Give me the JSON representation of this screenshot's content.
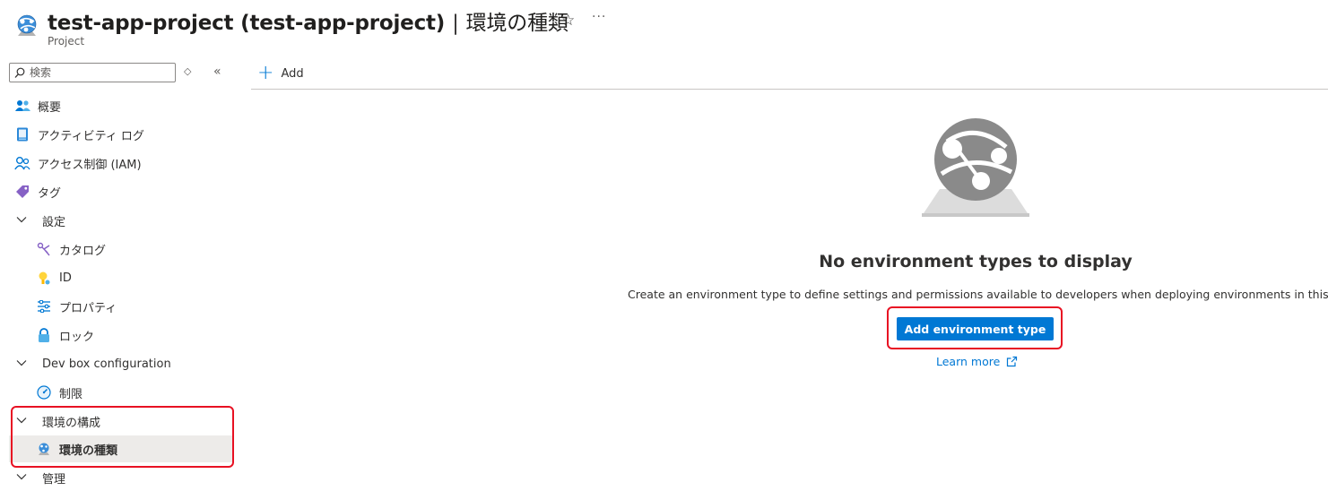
{
  "header": {
    "title": "test-app-project (test-app-project)",
    "separator": "|",
    "subtitle_jp": "環境の種類",
    "resource_type": "Project",
    "favorite_icon": "star-icon",
    "more_icon": "ellipsis-icon"
  },
  "sidebar": {
    "search_placeholder": "検索",
    "items": [
      {
        "label": "概要",
        "icon": "people-icon"
      },
      {
        "label": "アクティビティ ログ",
        "icon": "activity-log-icon"
      },
      {
        "label": "アクセス制御 (IAM)",
        "icon": "access-control-icon"
      },
      {
        "label": "タグ",
        "icon": "tag-icon"
      },
      {
        "label": "設定",
        "icon": "chevron-down-icon"
      },
      {
        "label": "カタログ",
        "icon": "catalog-icon"
      },
      {
        "label": "ID",
        "icon": "identity-icon"
      },
      {
        "label": "プロパティ",
        "icon": "properties-icon"
      },
      {
        "label": "ロック",
        "icon": "lock-icon"
      },
      {
        "label": "Dev box configuration",
        "icon": "chevron-down-icon"
      },
      {
        "label": "制限",
        "icon": "limits-icon"
      },
      {
        "label": "環境の構成",
        "icon": "chevron-down-icon"
      },
      {
        "label": "環境の種類",
        "icon": "environment-type-icon"
      },
      {
        "label": "管理",
        "icon": "chevron-down-icon"
      }
    ]
  },
  "toolbar": {
    "add_label": "Add"
  },
  "empty_state": {
    "title": "No environment types to display",
    "description": "Create an environment type to define settings and permissions available to developers when deploying environments in this project.",
    "primary_button": "Add environment type",
    "learn_more": "Learn more"
  },
  "colors": {
    "accent": "#0078d4",
    "highlight": "#e81123",
    "selected_bg": "#edebe9"
  }
}
